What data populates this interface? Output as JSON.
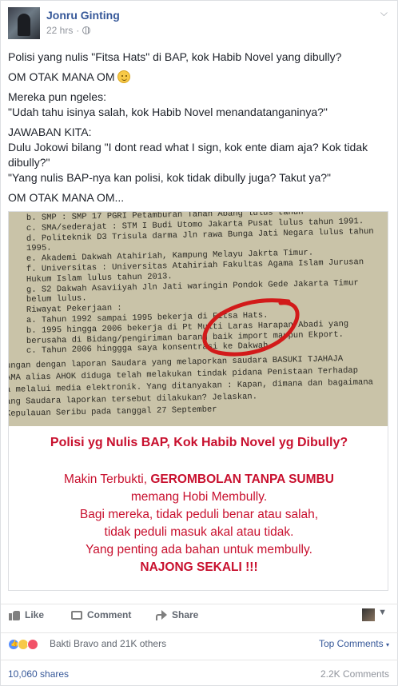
{
  "post": {
    "author": "Jonru Ginting",
    "time": "22 hrs",
    "time_sep": "·",
    "options_icon": "chevron-down-icon",
    "paragraphs": [
      "Polisi yang nulis \"Fitsa Hats\" di BAP, kok Habib Novel yang dibully?",
      "OM OTAK MANA OM",
      "Mereka pun ngeles:",
      "\"Udah tahu isinya salah, kok Habib Novel menandatanganinya?\"",
      "JAWABAN KITA:",
      "Dulu Jokowi bilang \"I dont read what I sign, kok ente diam aja? Kok tidak dibully?\"",
      "\"Yang nulis BAP-nya kan polisi, kok tidak dibully juga? Takut ya?\"",
      "OM OTAK MANA OM..."
    ]
  },
  "document": {
    "lines": [
      "b.  SMP : SMP 17 PGRI Petamburan Tanah Abang lulus tahun",
      "c.  SMA/sederajat  : STM I Budi Utomo Jakarta Pusat lulus tahun 1991.",
      "d.  Politeknik D3 Trisula darma Jln rawa Bunga Jati Negara lulus tahun",
      "     1995.",
      "e.  Akademi Dakwah Atahiriah, Kampung Melayu Jakrta Timur.",
      "f.  Universitas : Universitas Atahiriah Fakultas Agama Islam Jurusan",
      "     Hukum Islam lulus tahun 2013.",
      "g.  S2 Dakwah Asaviiyah Jln Jati waringin Pondok Gede Jakarta Timur",
      "     belum lulus.",
      "Riwayat Pekerjaan :",
      "a.  Tahun 1992 sampai 1995 bekerja di Fitsa Hats.",
      "b.  1995 hingga 2006 bekerja di Pt Multi Laras Harapan Abadi yang",
      "     berusaha di Bidang/pengiriman barang baik import maupun Ekport.",
      "c.  Tahun 2006 hinggga saya konsentrasi ke Dakwah.",
      "",
      "ungan dengan laporan Saudara yang melaporkan saudara BASUKI TJAHAJA",
      "AMA alias AHOK diduga telah melakukan tindak pidana Penistaan Terhadap",
      "a melalui media elektronik. Yang ditanyakan : Kapan, dimana dan bagaimana",
      "ang Saudara laporkan tersebut dilakukan? Jelaskan.",
      "                     Kepulauan Seribu pada tanggal 27 September"
    ]
  },
  "caption": {
    "title": "Polisi yg Nulis BAP, Kok Habib Novel yg Dibully?",
    "line1_prefix": "Makin Terbukti, ",
    "line1_bold": "GEROMBOLAN TANPA SUMBU",
    "line2": "memang Hobi Membully.",
    "line3": "Bagi mereka, tidak peduli benar atau salah,",
    "line4": "tidak peduli masuk akal atau tidak.",
    "line5": "Yang penting ada bahan untuk membully.",
    "line6": "NAJONG SEKALI !!!"
  },
  "actions": {
    "like": "Like",
    "comment": "Comment",
    "share": "Share"
  },
  "reactions": {
    "names": "Bakti Bravo and 21K others",
    "sort": "Top Comments"
  },
  "stats": {
    "shares": "10,060 shares",
    "comments": "2.2K Comments"
  },
  "colors": {
    "link_blue": "#365899",
    "caption_red": "#c8102e",
    "meta_gray": "#90949c"
  }
}
